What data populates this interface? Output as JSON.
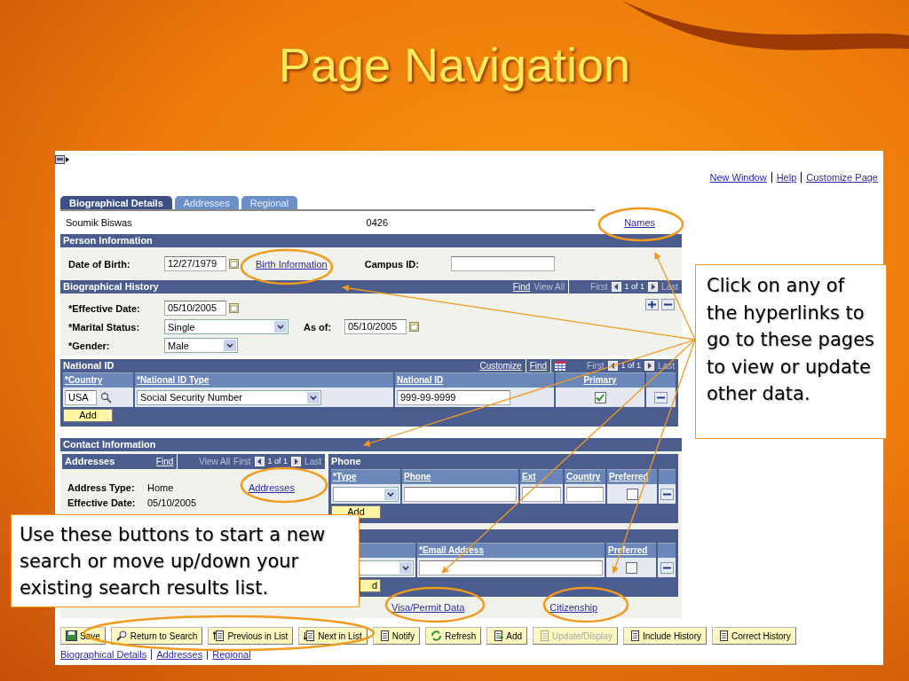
{
  "slide_title": "Page Navigation",
  "screen": {
    "top_links": [
      "New Window",
      "Help",
      "Customize Page"
    ],
    "tabs": [
      {
        "label": "Biographical Details",
        "selected": true
      },
      {
        "label": "Addresses",
        "selected": false
      },
      {
        "label": "Regional",
        "selected": false
      }
    ],
    "header": {
      "name": "Soumik Biswas",
      "id": "0426",
      "link": "Names"
    },
    "person_information": {
      "title": "Person Information",
      "dob_label": "Date of Birth:",
      "dob_value": "12/27/1979",
      "link": "Birth Information",
      "campus_label": "Campus ID:"
    },
    "biographical_history": {
      "title": "Biographical History",
      "nav": {
        "find": "Find",
        "view_all": "View All",
        "first": "First",
        "count": "1 of 1",
        "last": "Last"
      },
      "effective_label": "*Effective Date:",
      "effective_value": "05/10/2005",
      "marital_label": "*Marital Status:",
      "marital_value": "Single",
      "as_of_label": "As of:",
      "as_of_value": "05/10/2005",
      "gender_label": "*Gender:",
      "gender_value": "Male"
    },
    "national_id": {
      "title": "National ID",
      "nav": {
        "customize": "Customize",
        "find": "Find",
        "first": "First",
        "count": "1 of 1",
        "last": "Last"
      },
      "columns": [
        "*Country",
        "*National ID Type",
        "National ID",
        "Primary"
      ],
      "row": {
        "country": "USA",
        "type": "Social Security Number",
        "national_id": "999-99-9999",
        "primary": true
      },
      "add": "Add"
    },
    "contact_information": {
      "title": "Contact Information",
      "addresses": {
        "title": "Addresses",
        "nav": {
          "find": "Find",
          "view_all": "View All",
          "first": "First",
          "count": "1 of 1",
          "last": "Last"
        },
        "type_label": "Address Type:",
        "type_value": "Home",
        "date_label": "Effective Date:",
        "date_value": "05/10/2005",
        "link": "Addresses"
      },
      "phone": {
        "title": "Phone",
        "columns": [
          "*Type",
          "Phone",
          "Ext",
          "Country",
          "Preferred"
        ],
        "preferred": false,
        "add": "Add"
      },
      "email": {
        "columns": [
          "*Email Address",
          "Preferred"
        ],
        "preferred": false,
        "add": "d"
      }
    },
    "links": [
      "Visa/Permit Data",
      "Citizenship"
    ],
    "buttons": [
      {
        "label": "Save",
        "disabled": false
      },
      {
        "label": "Return to Search",
        "disabled": false
      },
      {
        "label": "Previous in List",
        "disabled": false
      },
      {
        "label": "Next in List",
        "disabled": false
      },
      {
        "label": "Notify",
        "disabled": false
      },
      {
        "label": "Refresh",
        "disabled": false
      },
      {
        "label": "Add",
        "disabled": false
      },
      {
        "label": "Update/Display",
        "disabled": true
      },
      {
        "label": "Include History",
        "disabled": false
      },
      {
        "label": "Correct History",
        "disabled": false
      }
    ],
    "footer_links": [
      "Biographical Details",
      "Addresses",
      "Regional"
    ]
  },
  "callouts": [
    "Click on any of the hyperlinks to go to these pages to view or update other data.",
    "Use these buttons to start a new search or move up/down your existing search results list."
  ]
}
